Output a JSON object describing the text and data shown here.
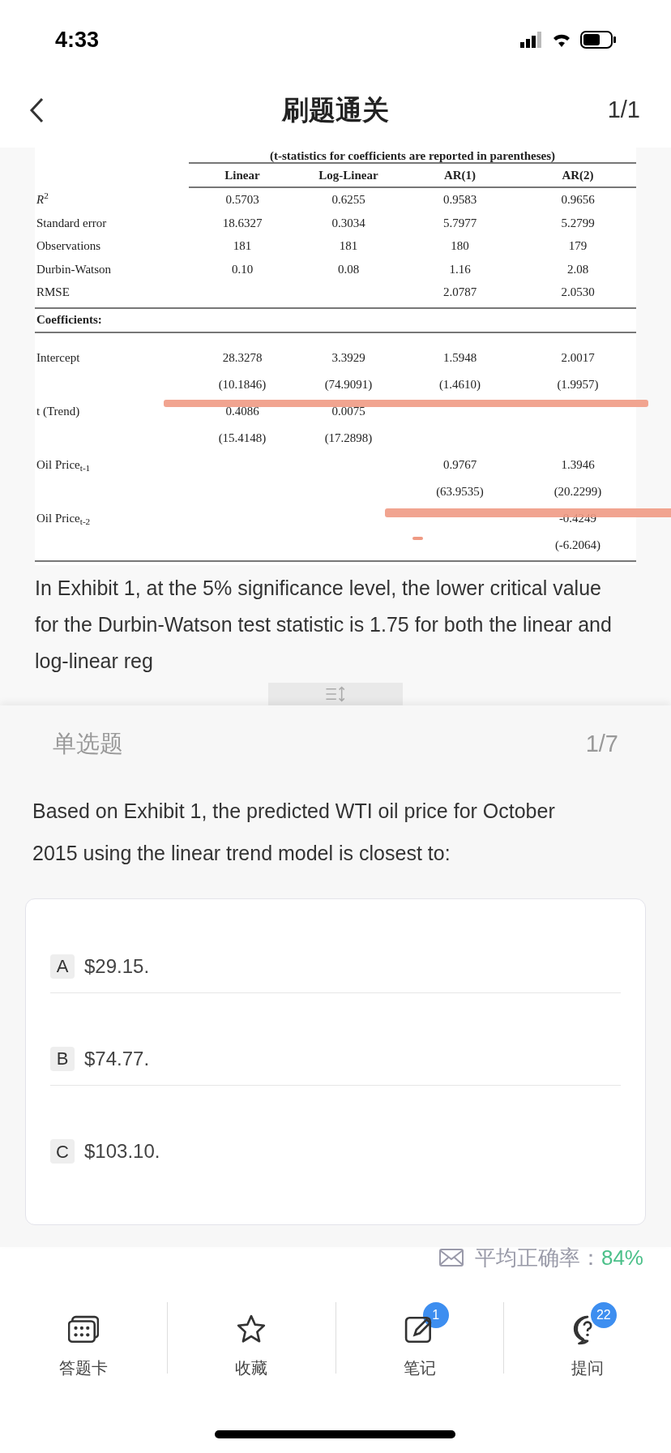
{
  "status_bar": {
    "time": "4:33"
  },
  "nav": {
    "title": "刷题通关",
    "counter": "1/1"
  },
  "exhibit": {
    "caption": "(t-statistics for coefficients are reported in parentheses)",
    "columns": [
      "Linear",
      "Log-Linear",
      "AR(1)",
      "AR(2)"
    ],
    "stats": [
      {
        "label": "*R*$^{2}$",
        "values": {
          "linear": "0.5703",
          "log_linear": "0.6255",
          "ar_1": "0.9583",
          "ar_2": "0.9656"
        }
      },
      {
        "label": "Standard error",
        "values": {
          "linear": "18.6327",
          "log_linear": "0.3034",
          "ar_1": "5.7977",
          "ar_2": "5.2799"
        }
      },
      {
        "label": "Observations",
        "values": {
          "linear": "181",
          "log_linear": "181",
          "ar_1": "180",
          "ar_2": "179"
        }
      },
      {
        "label": "Durbin-Watson",
        "values": {
          "linear": "0.10",
          "log_linear": "0.08",
          "ar_1": "1.16",
          "ar_2": "2.08"
        }
      },
      {
        "label": "RMSE",
        "values": {
          "ar_1": "2.0787",
          "ar_2": "2.0530"
        }
      }
    ],
    "coefficients_heading": "Coefficients:",
    "coefficients": [
      {
        "label": "Intercept",
        "values": {
          "linear": "28.3278",
          "log_linear": "3.3929",
          "ar_1": "1.5948",
          "ar_2": "2.0017"
        },
        "t_stats": {
          "linear": "(10.1846)",
          "log_linear": "(74.9091)",
          "ar_1": "(1.4610)",
          "ar_2": "(1.9957)"
        }
      },
      {
        "label": "t (Trend)",
        "values": {
          "linear": "0.4086",
          "log_linear": "0.0075"
        },
        "t_stats": {
          "linear": "(15.4148)",
          "log_linear": "(17.2898)"
        }
      },
      {
        "label": "Oil Price$_{t-1}$",
        "values": {
          "ar_1": "0.9767",
          "ar_2": "1.3946"
        },
        "t_stats": {
          "ar_1": "(63.9535)",
          "ar_2": "(20.2299)"
        }
      },
      {
        "label": "Oil Price$_{t-2}$",
        "values": {
          "ar_2": "-0.4249"
        },
        "t_stats": {
          "ar_2": "(-6.2064)"
        }
      }
    ]
  },
  "passage": "In Exhibit 1, at the 5% significance level, the lower critical value for the Durbin-Watson test statistic is 1.75 for both the linear and log-linear reg",
  "question": {
    "type": "单选题",
    "counter": "1/7",
    "text": "Based on Exhibit 1, the predicted WTI oil price for October 2015 using the linear trend model is closest to:",
    "options": [
      {
        "letter": "A",
        "text": "$29.15.",
        "selected": false
      },
      {
        "letter": "B",
        "text": "$74.77.",
        "selected": false
      },
      {
        "letter": "C",
        "text": "$103.10.",
        "selected": false
      }
    ]
  },
  "accuracy": {
    "label": "平均正确率：",
    "value": "84%"
  },
  "tab_bar": [
    {
      "kind": "card",
      "label": "答题卡"
    },
    {
      "kind": "star",
      "label": "收藏"
    },
    {
      "kind": "note",
      "label": "笔记",
      "badge": "1"
    },
    {
      "kind": "question",
      "label": "提问",
      "badge": "22"
    }
  ]
}
